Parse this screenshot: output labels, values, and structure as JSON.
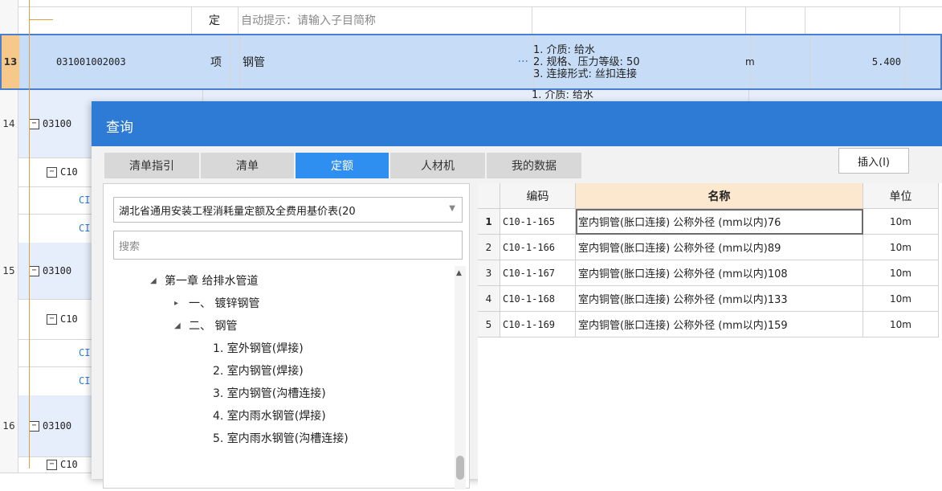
{
  "background": {
    "row_hint": {
      "type": "定",
      "name": "自动提示：请输入子目简称"
    },
    "row13": {
      "num": "13",
      "code": "031001002003",
      "type": "项",
      "name": "钢管",
      "ellipsis": "···",
      "features": [
        "1. 介质: 给水",
        "2. 规格、压力等级: 50",
        "3. 连接形式: 丝扣连接"
      ],
      "unit": "m",
      "qty": "5.400"
    },
    "row14": {
      "num": "14",
      "code": "03100",
      "feature_partial": "1. 介质: 给水"
    },
    "row14_sub": {
      "code": "C10"
    },
    "row14_c1": {
      "code": "CI"
    },
    "row14_c2": {
      "code": "CI"
    },
    "row15": {
      "num": "15",
      "code": "03100"
    },
    "row15_sub": {
      "code": "C10"
    },
    "row15_c1": {
      "code": "CI"
    },
    "row15_c2": {
      "code": "CI"
    },
    "row16": {
      "num": "16",
      "code": "03100"
    },
    "row16_sub": {
      "code": "C10"
    }
  },
  "dialog": {
    "title": "查询",
    "tabs": [
      "清单指引",
      "清单",
      "定额",
      "人材机",
      "我的数据"
    ],
    "active_tab": "定额",
    "insert_button": "插入(I)",
    "quota_library": "湖北省通用安装工程消耗量定额及全费用基价表(20",
    "search_placeholder": "搜索",
    "tree": [
      {
        "label": "第一章 给排水管道",
        "expander": "◢"
      },
      {
        "label": "一、 镀锌钢管",
        "expander": "▸"
      },
      {
        "label": "二、 钢管",
        "expander": "◢"
      },
      {
        "label": "1. 室外钢管(焊接)"
      },
      {
        "label": "2. 室内钢管(焊接)"
      },
      {
        "label": "3. 室内钢管(沟槽连接)"
      },
      {
        "label": "4. 室内雨水钢管(焊接)"
      },
      {
        "label": "5. 室内雨水钢管(沟槽连接)"
      }
    ],
    "grid": {
      "headers": {
        "code": "编码",
        "name": "名称",
        "unit": "单位"
      },
      "rows": [
        {
          "idx": "1",
          "code": "C10-1-165",
          "name": "室内铜管(胀口连接) 公称外径 (mm以内)76",
          "unit": "10m"
        },
        {
          "idx": "2",
          "code": "C10-1-166",
          "name": "室内铜管(胀口连接) 公称外径 (mm以内)89",
          "unit": "10m"
        },
        {
          "idx": "3",
          "code": "C10-1-167",
          "name": "室内铜管(胀口连接) 公称外径 (mm以内)108",
          "unit": "10m"
        },
        {
          "idx": "4",
          "code": "C10-1-168",
          "name": "室内铜管(胀口连接) 公称外径 (mm以内)133",
          "unit": "10m"
        },
        {
          "idx": "5",
          "code": "C10-1-169",
          "name": "室内铜管(胀口连接) 公称外径 (mm以内)159",
          "unit": "10m"
        }
      ]
    }
  },
  "colors": {
    "title_bar": "#2e7bd6",
    "active_tab": "#2e8ff0",
    "selected_row": "#c7dcf7",
    "row_number_selected": "#f6c98a",
    "sort_header": "#fce8cf"
  }
}
